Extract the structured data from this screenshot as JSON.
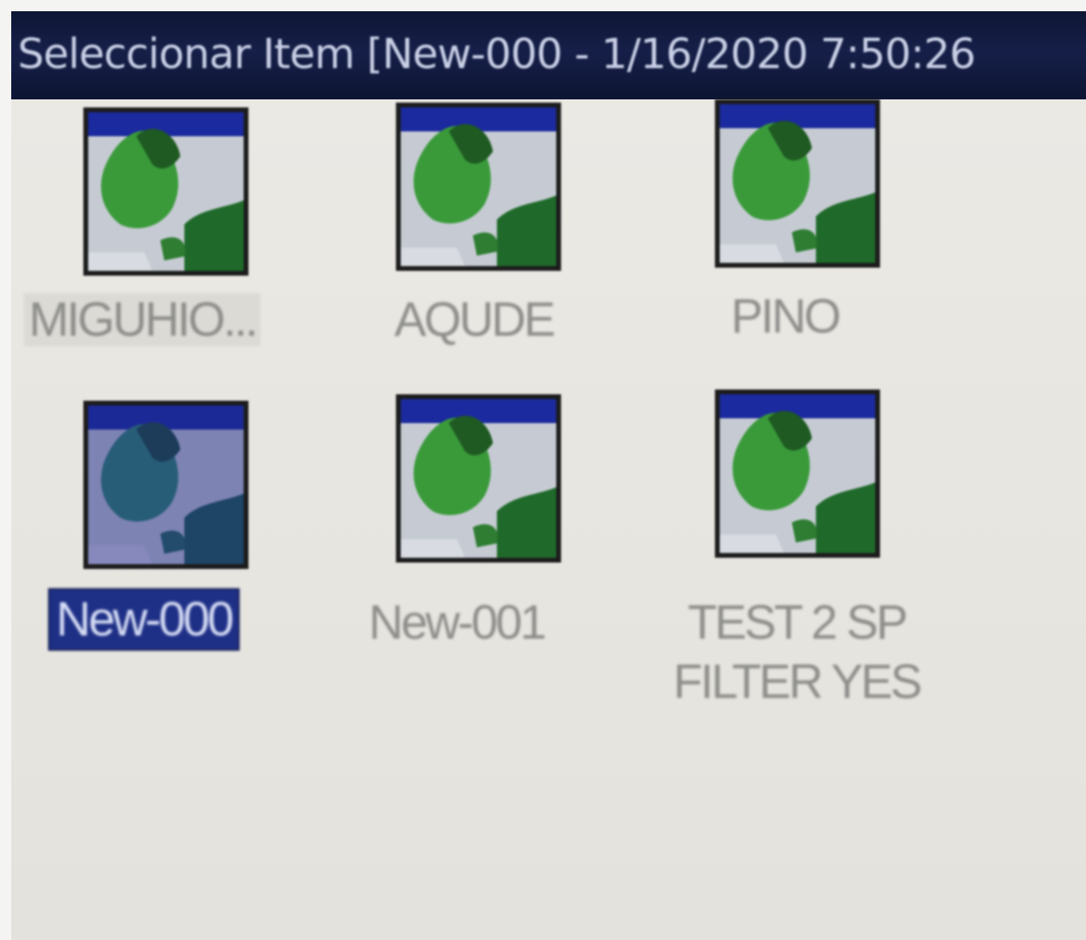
{
  "window": {
    "title": "Seleccionar Item [New-000 - 1/16/2020 7:50:26"
  },
  "items": [
    {
      "label": "MIGUHIO...",
      "selected": false
    },
    {
      "label": "AQUDE",
      "selected": false
    },
    {
      "label": "PINO",
      "selected": false
    },
    {
      "label": "New-000",
      "selected": true
    },
    {
      "label": "New-001",
      "selected": false
    },
    {
      "label": "TEST 2 SP FILTER YES",
      "selected": false
    }
  ],
  "colors": {
    "titlebar": "#111a3e",
    "selection": "#1e2f86",
    "thumbnail_blue": "#1b2a9e",
    "thumbnail_green": "#3a9a3a",
    "background": "#e6e4df"
  },
  "icons": {
    "item_thumbnail": "cylinder-head-icon"
  }
}
